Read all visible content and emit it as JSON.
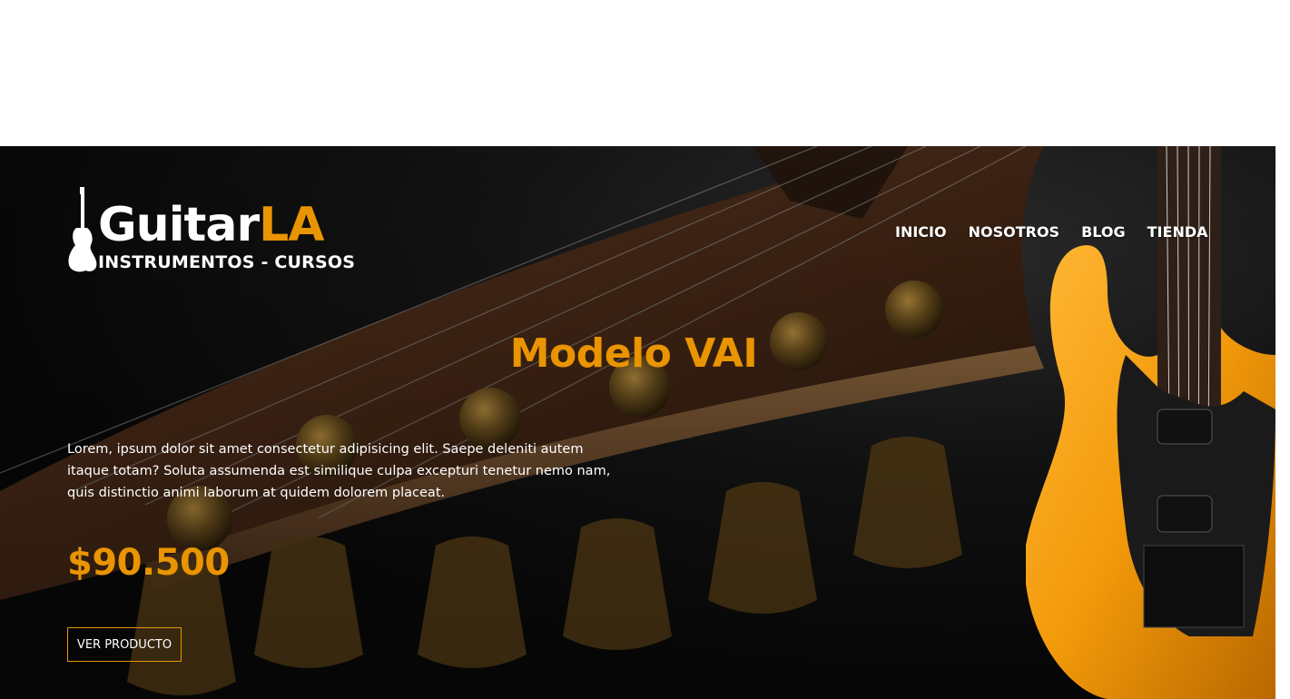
{
  "brand": {
    "name_main": "Guitar",
    "name_accent": "LA",
    "tagline": "INSTRUMENTOS - CURSOS"
  },
  "nav": [
    {
      "label": "INICIO"
    },
    {
      "label": "NOSOTROS"
    },
    {
      "label": "BLOG"
    },
    {
      "label": "TIENDA"
    }
  ],
  "hero": {
    "title": "Modelo VAI",
    "description": "Lorem, ipsum dolor sit amet consectetur adipisicing elit. Saepe deleniti autem itaque totam? Soluta assumenda est similique culpa excepturi tenetur nemo nam, quis distinctio animi laborum at quidem dolorem placeat.",
    "price": "$90.500",
    "cta_label": "VER PRODUCTO"
  },
  "colors": {
    "accent": "#e99401",
    "text": "#ffffff",
    "background": "#0a0a0a"
  },
  "icons": {
    "logo": "electric-guitar-icon"
  }
}
